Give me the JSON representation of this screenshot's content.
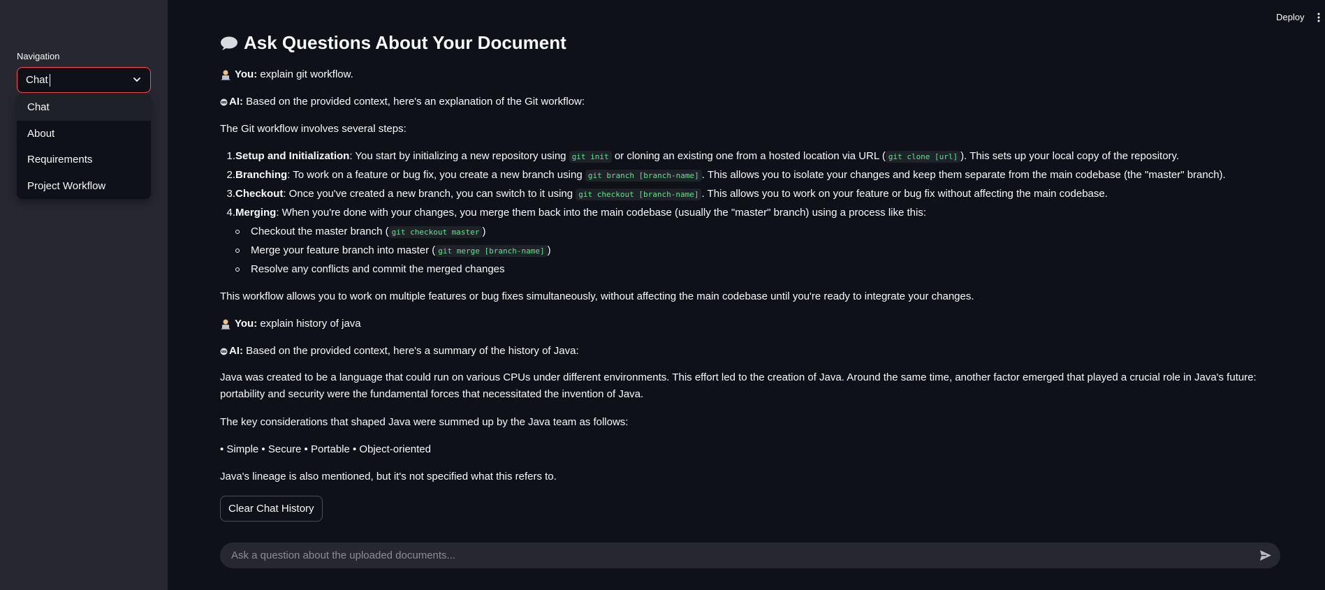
{
  "sidebar": {
    "nav_label": "Navigation",
    "select_value": "Chat",
    "options": [
      "Chat",
      "About",
      "Requirements",
      "Project Workflow"
    ]
  },
  "header": {
    "deploy": "Deploy"
  },
  "main": {
    "title": "Ask Questions About Your Document",
    "messages": {
      "q1": {
        "speaker": "You:",
        "text": "explain git workflow."
      },
      "a1": {
        "speaker": "AI:",
        "text": "Based on the provided context, here's an explanation of the Git workflow:",
        "intro": "The Git workflow involves several steps:",
        "steps": [
          {
            "num": "1.",
            "title": "Setup and Initialization",
            "t1": ": You start by initializing a new repository using ",
            "c1": "git init",
            "t2": " or cloning an existing one from a hosted location via URL (",
            "c2": "git clone [url]",
            "t3": "). This sets up your local copy of the repository."
          },
          {
            "num": "2.",
            "title": "Branching",
            "t1": ": To work on a feature or bug fix, you create a new branch using ",
            "c1": "git branch [branch-name]",
            "t2": ". This allows you to isolate your changes and keep them separate from the main codebase (the \"master\" branch)."
          },
          {
            "num": "3.",
            "title": "Checkout",
            "t1": ": Once you've created a new branch, you can switch to it using ",
            "c1": "git checkout [branch-name]",
            "t2": ". This allows you to work on your feature or bug fix without affecting the main codebase."
          },
          {
            "num": "4.",
            "title": "Merging",
            "t1": ": When you're done with your changes, you merge them back into the main codebase (usually the \"master\" branch) using a process like this:"
          }
        ],
        "subitems": [
          {
            "t1": "Checkout the master branch (",
            "c1": "git checkout master",
            "t2": ")"
          },
          {
            "t1": "Merge your feature branch into master (",
            "c1": "git merge [branch-name]",
            "t2": ")"
          },
          {
            "t1": "Resolve any conflicts and commit the merged changes"
          }
        ],
        "outro": "This workflow allows you to work on multiple features or bug fixes simultaneously, without affecting the main codebase until you're ready to integrate your changes."
      },
      "q2": {
        "speaker": "You:",
        "text": "explain history of java"
      },
      "a2": {
        "speaker": "AI:",
        "text": "Based on the provided context, here's a summary of the history of Java:",
        "p1": "Java was created to be a language that could run on various CPUs under different environments. This effort led to the creation of Java. Around the same time, another factor emerged that played a crucial role in Java's future: portability and security were the fundamental forces that necessitated the invention of Java.",
        "p2": "The key considerations that shaped Java were summed up by the Java team as follows:",
        "p3": "• Simple • Secure • Portable • Object-oriented",
        "p4": "Java's lineage is also mentioned, but it's not specified what this refers to."
      }
    },
    "clear_button": "Clear Chat History",
    "chat_input_placeholder": "Ask a question about the uploaded documents..."
  },
  "colors": {
    "background": "#0e1117",
    "sidebar": "#262730",
    "accent": "#ff4b4b",
    "code": "#5ce488"
  },
  "icons": [
    "chat-bubble-icon",
    "user-icon",
    "robot-icon",
    "chevron-down-icon",
    "send-icon",
    "more-vert-icon"
  ]
}
